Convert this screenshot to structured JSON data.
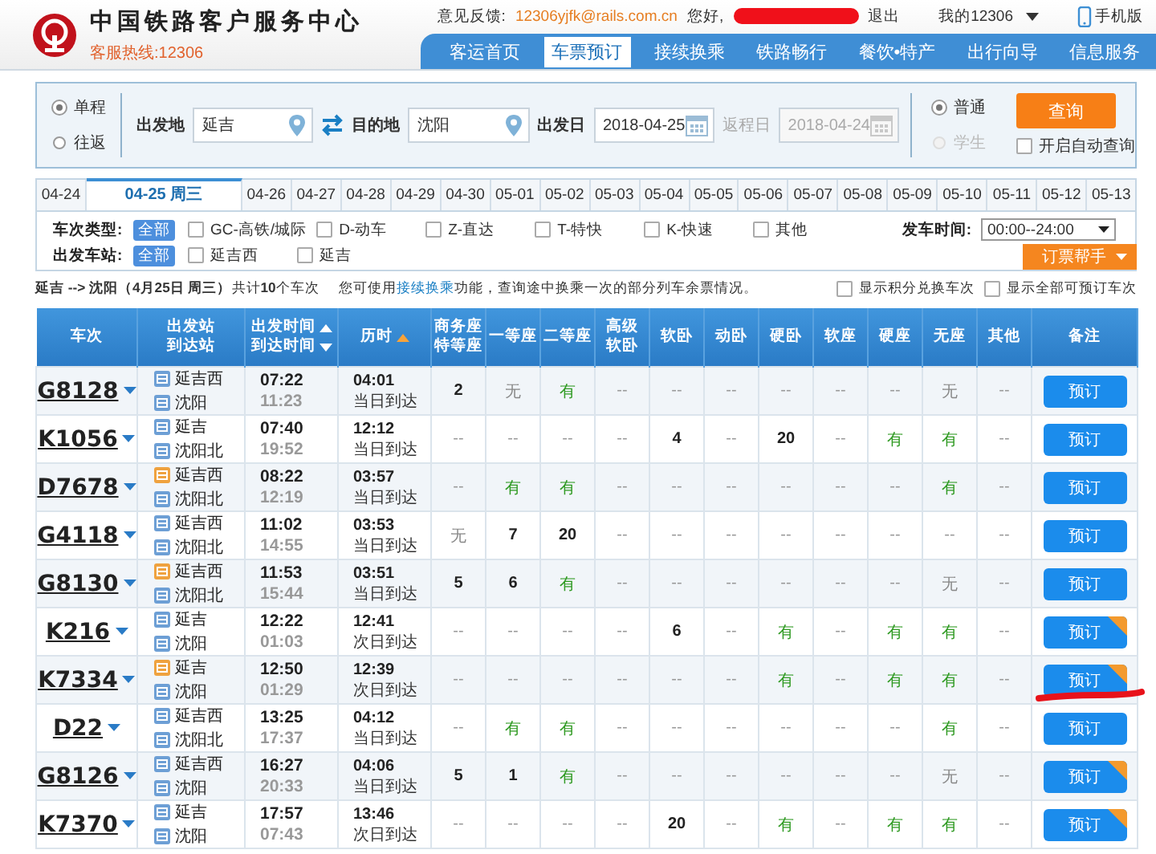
{
  "header": {
    "title": "中国铁路客户服务中心",
    "hotline": "客服热线:12306",
    "feedback_label": "意见反馈:",
    "feedback_email": "12306yjfk@rails.com.cn",
    "greeting": "您好,",
    "logout": "退出",
    "my_account": "我的12306",
    "mobile": "手机版",
    "nav": [
      {
        "label": "客运首页",
        "selected": false
      },
      {
        "label": "车票预订",
        "selected": true
      },
      {
        "label": "接续换乘",
        "selected": false
      },
      {
        "label": "铁路畅行",
        "selected": false
      },
      {
        "label": "餐饮•特产",
        "selected": false
      },
      {
        "label": "出行向导",
        "selected": false
      },
      {
        "label": "信息服务",
        "selected": false
      }
    ]
  },
  "search": {
    "trip_types": [
      {
        "label": "单程",
        "selected": true
      },
      {
        "label": "往返",
        "selected": false
      }
    ],
    "from_label": "出发地",
    "from": "延吉",
    "to_label": "目的地",
    "to": "沈阳",
    "date_label": "出发日",
    "date": "2018-04-25",
    "return_label": "返程日",
    "return_date": "2018-04-24",
    "return_disabled": true,
    "passenger_types": [
      {
        "label": "普通",
        "selected": true,
        "disabled": false
      },
      {
        "label": "学生",
        "selected": false,
        "disabled": true
      }
    ],
    "query_button": "查询",
    "auto_query": {
      "label": "开启自动查询",
      "checked": false
    }
  },
  "dates": [
    {
      "label": "04-24",
      "selected": false
    },
    {
      "label": "04-25 周三",
      "selected": true
    },
    {
      "label": "04-26",
      "selected": false
    },
    {
      "label": "04-27",
      "selected": false
    },
    {
      "label": "04-28",
      "selected": false
    },
    {
      "label": "04-29",
      "selected": false
    },
    {
      "label": "04-30",
      "selected": false
    },
    {
      "label": "05-01",
      "selected": false
    },
    {
      "label": "05-02",
      "selected": false
    },
    {
      "label": "05-03",
      "selected": false
    },
    {
      "label": "05-04",
      "selected": false
    },
    {
      "label": "05-05",
      "selected": false
    },
    {
      "label": "05-06",
      "selected": false
    },
    {
      "label": "05-07",
      "selected": false
    },
    {
      "label": "05-08",
      "selected": false
    },
    {
      "label": "05-09",
      "selected": false
    },
    {
      "label": "05-10",
      "selected": false
    },
    {
      "label": "05-11",
      "selected": false
    },
    {
      "label": "05-12",
      "selected": false
    },
    {
      "label": "05-13",
      "selected": false
    }
  ],
  "filters": {
    "type_label": "车次类型:",
    "type_all": "全部",
    "types": [
      {
        "label": "GC-高铁/城际",
        "checked": false
      },
      {
        "label": "D-动车",
        "checked": false
      },
      {
        "label": "Z-直达",
        "checked": false
      },
      {
        "label": "T-特快",
        "checked": false
      },
      {
        "label": "K-快速",
        "checked": false
      },
      {
        "label": "其他",
        "checked": false
      }
    ],
    "station_label": "出发车站:",
    "station_all": "全部",
    "stations": [
      {
        "label": "延吉西",
        "checked": false
      },
      {
        "label": "延吉",
        "checked": false
      }
    ],
    "time_label": "发车时间:",
    "time_value": "00:00--24:00",
    "helper_button": "订票帮手"
  },
  "summary": {
    "route": "**延吉 --> 沈阳（4月25日 周三）**共计**10**个车次",
    "tip_before": "您可使用",
    "tip_link": "接续换乘",
    "tip_after": "功能，查询途中换乘一次的部分列车余票情况。",
    "options": [
      {
        "label": "显示积分兑换车次",
        "checked": false
      },
      {
        "label": "显示全部可预订车次",
        "checked": false
      }
    ]
  },
  "table": {
    "columns": [
      {
        "lines": [
          {
            "text": "车次"
          }
        ]
      },
      {
        "lines": [
          {
            "text": "出发站"
          },
          {
            "text": "到达站"
          }
        ]
      },
      {
        "lines": [
          {
            "text": "出发时间",
            "kind": "sort_up"
          },
          {
            "text": "到达时间",
            "kind": "sort_down"
          }
        ]
      },
      {
        "lines": [
          {
            "text": "历时",
            "kind": "sort_up",
            "highlight": true
          }
        ]
      },
      {
        "lines": [
          {
            "text": "商务座"
          },
          {
            "text": "特等座"
          }
        ]
      },
      {
        "lines": [
          {
            "text": "一等座"
          }
        ]
      },
      {
        "lines": [
          {
            "text": "二等座"
          }
        ]
      },
      {
        "lines": [
          {
            "text": "高级"
          },
          {
            "text": "软卧"
          }
        ]
      },
      {
        "lines": [
          {
            "text": "软卧"
          }
        ]
      },
      {
        "lines": [
          {
            "text": "动卧"
          }
        ]
      },
      {
        "lines": [
          {
            "text": "硬卧"
          }
        ]
      },
      {
        "lines": [
          {
            "text": "软座"
          }
        ]
      },
      {
        "lines": [
          {
            "text": "硬座"
          }
        ]
      },
      {
        "lines": [
          {
            "text": "无座"
          }
        ]
      },
      {
        "lines": [
          {
            "text": "其他"
          }
        ]
      },
      {
        "lines": [
          {
            "text": "备注"
          }
        ]
      }
    ],
    "rows": [
      {
        "train": "G8128",
        "from": {
          "name": "延吉西",
          "kind": "pass"
        },
        "to": {
          "name": "沈阳",
          "kind": "pass"
        },
        "depart": "07:22",
        "arrive": "11:23",
        "duration": "04:01",
        "arrival_day": "当日到达",
        "seats": [
          {
            "text": "2",
            "kind": "count"
          },
          {
            "text": "无",
            "kind": "no"
          },
          {
            "text": "有",
            "kind": "yes"
          },
          {
            "text": "--",
            "kind": "na"
          },
          {
            "text": "--",
            "kind": "na"
          },
          {
            "text": "--",
            "kind": "na"
          },
          {
            "text": "--",
            "kind": "na"
          },
          {
            "text": "--",
            "kind": "na"
          },
          {
            "text": "--",
            "kind": "na"
          },
          {
            "text": "无",
            "kind": "no"
          },
          {
            "text": "--",
            "kind": "na"
          }
        ],
        "button": "预订",
        "corner": false
      },
      {
        "train": "K1056",
        "from": {
          "name": "延吉",
          "kind": "pass"
        },
        "to": {
          "name": "沈阳北",
          "kind": "pass"
        },
        "depart": "07:40",
        "arrive": "19:52",
        "duration": "12:12",
        "arrival_day": "当日到达",
        "seats": [
          {
            "text": "--",
            "kind": "na"
          },
          {
            "text": "--",
            "kind": "na"
          },
          {
            "text": "--",
            "kind": "na"
          },
          {
            "text": "--",
            "kind": "na"
          },
          {
            "text": "4",
            "kind": "count"
          },
          {
            "text": "--",
            "kind": "na"
          },
          {
            "text": "20",
            "kind": "count"
          },
          {
            "text": "--",
            "kind": "na"
          },
          {
            "text": "有",
            "kind": "yes"
          },
          {
            "text": "有",
            "kind": "yes"
          },
          {
            "text": "--",
            "kind": "na"
          }
        ],
        "button": "预订",
        "corner": false
      },
      {
        "train": "D7678",
        "from": {
          "name": "延吉西",
          "kind": "start"
        },
        "to": {
          "name": "沈阳北",
          "kind": "pass"
        },
        "depart": "08:22",
        "arrive": "12:19",
        "duration": "03:57",
        "arrival_day": "当日到达",
        "seats": [
          {
            "text": "--",
            "kind": "na"
          },
          {
            "text": "有",
            "kind": "yes"
          },
          {
            "text": "有",
            "kind": "yes"
          },
          {
            "text": "--",
            "kind": "na"
          },
          {
            "text": "--",
            "kind": "na"
          },
          {
            "text": "--",
            "kind": "na"
          },
          {
            "text": "--",
            "kind": "na"
          },
          {
            "text": "--",
            "kind": "na"
          },
          {
            "text": "--",
            "kind": "na"
          },
          {
            "text": "有",
            "kind": "yes"
          },
          {
            "text": "--",
            "kind": "na"
          }
        ],
        "button": "预订",
        "corner": false
      },
      {
        "train": "G4118",
        "from": {
          "name": "延吉西",
          "kind": "pass"
        },
        "to": {
          "name": "沈阳北",
          "kind": "pass"
        },
        "depart": "11:02",
        "arrive": "14:55",
        "duration": "03:53",
        "arrival_day": "当日到达",
        "seats": [
          {
            "text": "无",
            "kind": "no"
          },
          {
            "text": "7",
            "kind": "count"
          },
          {
            "text": "20",
            "kind": "count"
          },
          {
            "text": "--",
            "kind": "na"
          },
          {
            "text": "--",
            "kind": "na"
          },
          {
            "text": "--",
            "kind": "na"
          },
          {
            "text": "--",
            "kind": "na"
          },
          {
            "text": "--",
            "kind": "na"
          },
          {
            "text": "--",
            "kind": "na"
          },
          {
            "text": "--",
            "kind": "na"
          },
          {
            "text": "--",
            "kind": "na"
          }
        ],
        "button": "预订",
        "corner": false
      },
      {
        "train": "G8130",
        "from": {
          "name": "延吉西",
          "kind": "start"
        },
        "to": {
          "name": "沈阳北",
          "kind": "pass"
        },
        "depart": "11:53",
        "arrive": "15:44",
        "duration": "03:51",
        "arrival_day": "当日到达",
        "seats": [
          {
            "text": "5",
            "kind": "count"
          },
          {
            "text": "6",
            "kind": "count"
          },
          {
            "text": "有",
            "kind": "yes"
          },
          {
            "text": "--",
            "kind": "na"
          },
          {
            "text": "--",
            "kind": "na"
          },
          {
            "text": "--",
            "kind": "na"
          },
          {
            "text": "--",
            "kind": "na"
          },
          {
            "text": "--",
            "kind": "na"
          },
          {
            "text": "--",
            "kind": "na"
          },
          {
            "text": "无",
            "kind": "no"
          },
          {
            "text": "--",
            "kind": "na"
          }
        ],
        "button": "预订",
        "corner": false
      },
      {
        "train": "K216",
        "from": {
          "name": "延吉",
          "kind": "pass"
        },
        "to": {
          "name": "沈阳",
          "kind": "pass"
        },
        "depart": "12:22",
        "arrive": "01:03",
        "duration": "12:41",
        "arrival_day": "次日到达",
        "seats": [
          {
            "text": "--",
            "kind": "na"
          },
          {
            "text": "--",
            "kind": "na"
          },
          {
            "text": "--",
            "kind": "na"
          },
          {
            "text": "--",
            "kind": "na"
          },
          {
            "text": "6",
            "kind": "count"
          },
          {
            "text": "--",
            "kind": "na"
          },
          {
            "text": "有",
            "kind": "yes"
          },
          {
            "text": "--",
            "kind": "na"
          },
          {
            "text": "有",
            "kind": "yes"
          },
          {
            "text": "有",
            "kind": "yes"
          },
          {
            "text": "--",
            "kind": "na"
          }
        ],
        "button": "预订",
        "corner": true
      },
      {
        "train": "K7334",
        "from": {
          "name": "延吉",
          "kind": "start"
        },
        "to": {
          "name": "沈阳",
          "kind": "pass"
        },
        "depart": "12:50",
        "arrive": "01:29",
        "duration": "12:39",
        "arrival_day": "次日到达",
        "seats": [
          {
            "text": "--",
            "kind": "na"
          },
          {
            "text": "--",
            "kind": "na"
          },
          {
            "text": "--",
            "kind": "na"
          },
          {
            "text": "--",
            "kind": "na"
          },
          {
            "text": "--",
            "kind": "na"
          },
          {
            "text": "--",
            "kind": "na"
          },
          {
            "text": "有",
            "kind": "yes"
          },
          {
            "text": "--",
            "kind": "na"
          },
          {
            "text": "有",
            "kind": "yes"
          },
          {
            "text": "有",
            "kind": "yes"
          },
          {
            "text": "--",
            "kind": "na"
          }
        ],
        "button": "预订",
        "corner": true
      },
      {
        "train": "D22",
        "from": {
          "name": "延吉西",
          "kind": "pass"
        },
        "to": {
          "name": "沈阳北",
          "kind": "pass"
        },
        "depart": "13:25",
        "arrive": "17:37",
        "duration": "04:12",
        "arrival_day": "当日到达",
        "seats": [
          {
            "text": "--",
            "kind": "na"
          },
          {
            "text": "有",
            "kind": "yes"
          },
          {
            "text": "有",
            "kind": "yes"
          },
          {
            "text": "--",
            "kind": "na"
          },
          {
            "text": "--",
            "kind": "na"
          },
          {
            "text": "--",
            "kind": "na"
          },
          {
            "text": "--",
            "kind": "na"
          },
          {
            "text": "--",
            "kind": "na"
          },
          {
            "text": "--",
            "kind": "na"
          },
          {
            "text": "有",
            "kind": "yes"
          },
          {
            "text": "--",
            "kind": "na"
          }
        ],
        "button": "预订",
        "corner": false
      },
      {
        "train": "G8126",
        "from": {
          "name": "延吉西",
          "kind": "pass"
        },
        "to": {
          "name": "沈阳",
          "kind": "pass"
        },
        "depart": "16:27",
        "arrive": "20:33",
        "duration": "04:06",
        "arrival_day": "当日到达",
        "seats": [
          {
            "text": "5",
            "kind": "count"
          },
          {
            "text": "1",
            "kind": "count"
          },
          {
            "text": "有",
            "kind": "yes"
          },
          {
            "text": "--",
            "kind": "na"
          },
          {
            "text": "--",
            "kind": "na"
          },
          {
            "text": "--",
            "kind": "na"
          },
          {
            "text": "--",
            "kind": "na"
          },
          {
            "text": "--",
            "kind": "na"
          },
          {
            "text": "--",
            "kind": "na"
          },
          {
            "text": "无",
            "kind": "no"
          },
          {
            "text": "--",
            "kind": "na"
          }
        ],
        "button": "预订",
        "corner": true
      },
      {
        "train": "K7370",
        "from": {
          "name": "延吉",
          "kind": "pass"
        },
        "to": {
          "name": "沈阳",
          "kind": "pass"
        },
        "depart": "17:57",
        "arrive": "07:43",
        "duration": "13:46",
        "arrival_day": "次日到达",
        "seats": [
          {
            "text": "--",
            "kind": "na"
          },
          {
            "text": "--",
            "kind": "na"
          },
          {
            "text": "--",
            "kind": "na"
          },
          {
            "text": "--",
            "kind": "na"
          },
          {
            "text": "20",
            "kind": "count"
          },
          {
            "text": "--",
            "kind": "na"
          },
          {
            "text": "有",
            "kind": "yes"
          },
          {
            "text": "--",
            "kind": "na"
          },
          {
            "text": "有",
            "kind": "yes"
          },
          {
            "text": "有",
            "kind": "yes"
          },
          {
            "text": "--",
            "kind": "na"
          }
        ],
        "button": "预订",
        "corner": true
      }
    ]
  }
}
